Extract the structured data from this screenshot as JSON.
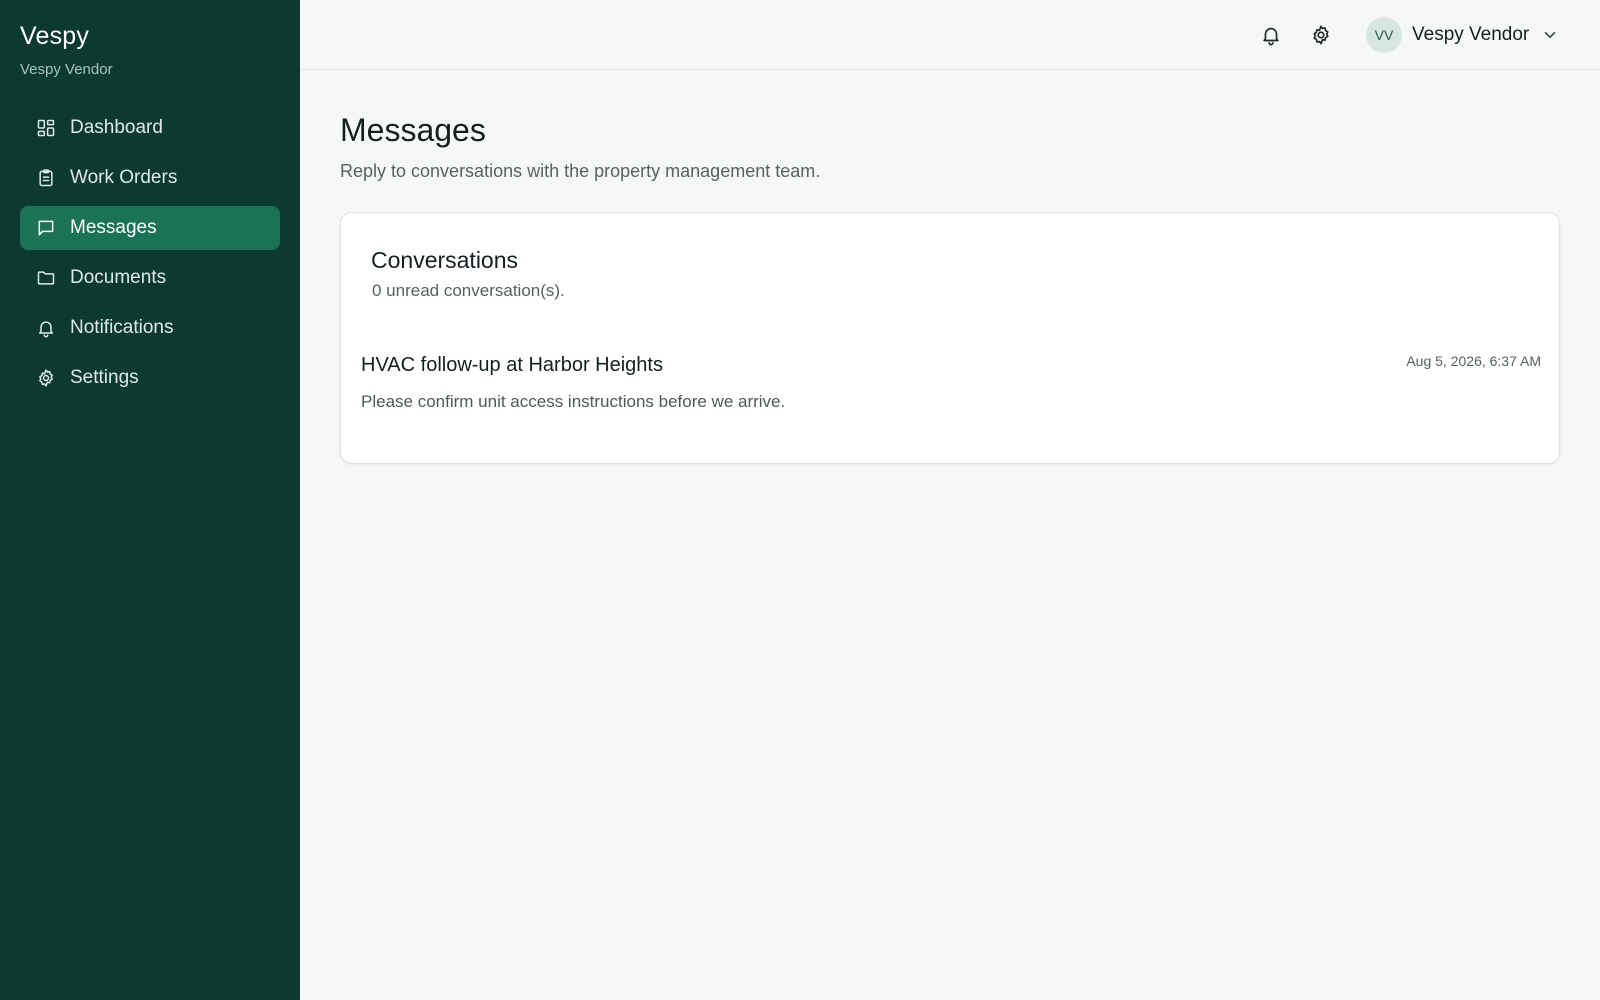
{
  "sidebar": {
    "brand": "Vespy",
    "subtitle": "Vespy Vendor",
    "items": [
      {
        "label": "Dashboard",
        "icon": "grid-icon",
        "active": false
      },
      {
        "label": "Work Orders",
        "icon": "clipboard-icon",
        "active": false
      },
      {
        "label": "Messages",
        "icon": "message-icon",
        "active": true
      },
      {
        "label": "Documents",
        "icon": "folder-icon",
        "active": false
      },
      {
        "label": "Notifications",
        "icon": "bell-icon",
        "active": false
      },
      {
        "label": "Settings",
        "icon": "gear-icon",
        "active": false
      }
    ]
  },
  "header": {
    "user": {
      "initials": "VV",
      "name": "Vespy Vendor"
    },
    "icons": [
      "bell-icon",
      "gear-icon",
      "chevron-down-icon"
    ]
  },
  "main": {
    "title": "Messages",
    "subtitle": "Reply to conversations with the property management team.",
    "card": {
      "title": "Conversations",
      "subtitle": "0 unread conversation(s).",
      "conversations": [
        {
          "subject": "HVAC follow-up at Harbor Heights",
          "preview": "Please confirm unit access instructions before we arrive.",
          "timestamp": "Aug 5, 2026, 6:37 AM"
        }
      ]
    }
  },
  "colors": {
    "sidebar_bg": "#0c3a30",
    "active_item": "#1c7257",
    "page_bg": "#f6f8f7",
    "avatar_bg": "#d8e6e0"
  }
}
